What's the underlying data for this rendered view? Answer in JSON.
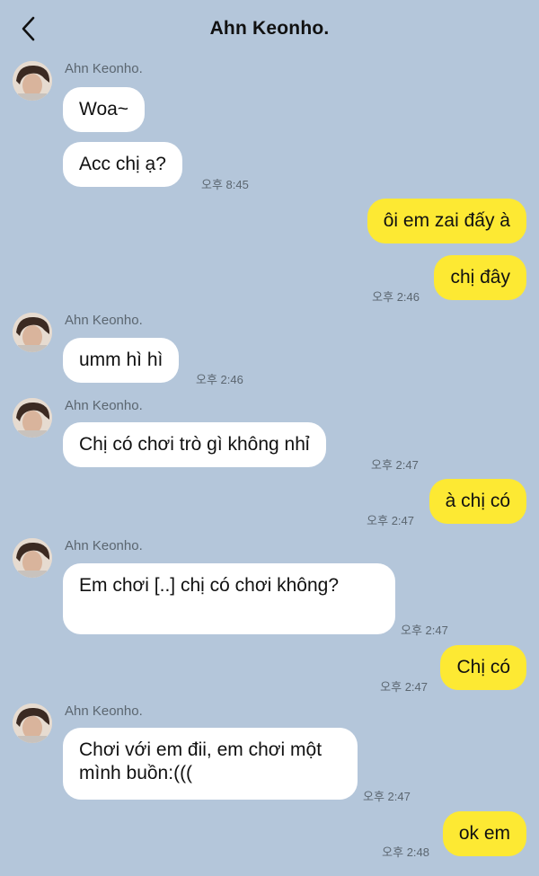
{
  "header": {
    "title": "Ahn Keonho.",
    "back_icon": "chevron-left-icon"
  },
  "colors": {
    "background": "#b4c6da",
    "incoming_bubble": "#ffffff",
    "outgoing_bubble": "#fde933"
  },
  "messages": [
    {
      "sender": "Ahn Keonho.",
      "text": "Woa~"
    },
    {
      "text": "Acc chị ạ?",
      "time": "오후 8:45"
    },
    {
      "text": "ôi em zai đấy à"
    },
    {
      "text": "chị đây",
      "time": "오후 2:46"
    },
    {
      "sender": "Ahn Keonho.",
      "text": "umm hì hì",
      "time": "오후 2:46"
    },
    {
      "sender": "Ahn Keonho.",
      "text": "Chị có chơi trò gì không nhỉ",
      "time": "오후 2:47"
    },
    {
      "text": "à chị có",
      "time": "오후 2:47"
    },
    {
      "sender": "Ahn Keonho.",
      "text": "Em chơi [..] chị có chơi không?",
      "time": "오후 2:47"
    },
    {
      "text": "Chị có",
      "time": "오후 2:47"
    },
    {
      "sender": "Ahn Keonho.",
      "text": "Chơi với em đii, em chơi một mình buồn:(((",
      "time": "오후 2:47"
    },
    {
      "text": "ok em",
      "time": "오후 2:48"
    }
  ]
}
